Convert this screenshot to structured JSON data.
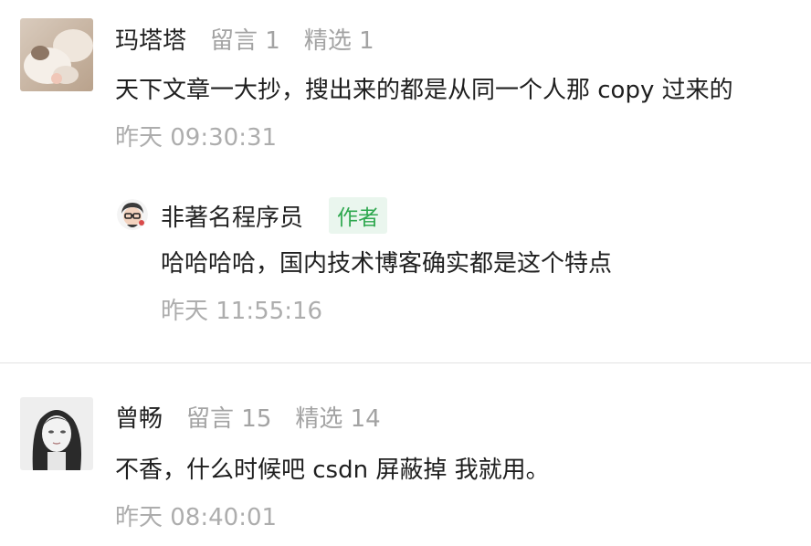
{
  "comments": [
    {
      "user": "玛塔塔",
      "messages_stat": "留言 1",
      "featured_stat": "精选 1",
      "content": "天下文章一大抄，搜出来的都是从同一个人那 copy 过来的",
      "time": "昨天 09:30:31",
      "reply": {
        "user": "非著名程序员",
        "badge": "作者",
        "content": "哈哈哈哈，国内技术博客确实都是这个特点",
        "time": "昨天 11:55:16"
      }
    },
    {
      "user": "曾畅",
      "messages_stat": "留言 15",
      "featured_stat": "精选 14",
      "content": "不香，什么时候吧 csdn 屏蔽掉 我就用。",
      "time": "昨天 08:40:01"
    }
  ],
  "colors": {
    "text_primary": "#1f1f1f",
    "text_secondary": "#a3a3a3",
    "author_badge_text": "#2fa84f",
    "author_badge_bg": "#eaf6ee",
    "divider": "#e3e3e3"
  },
  "icons": {
    "avatar_1": "cat-photo-avatar",
    "avatar_2": "woman-portrait-avatar",
    "reply_avatar": "cartoon-glasses-avatar"
  }
}
